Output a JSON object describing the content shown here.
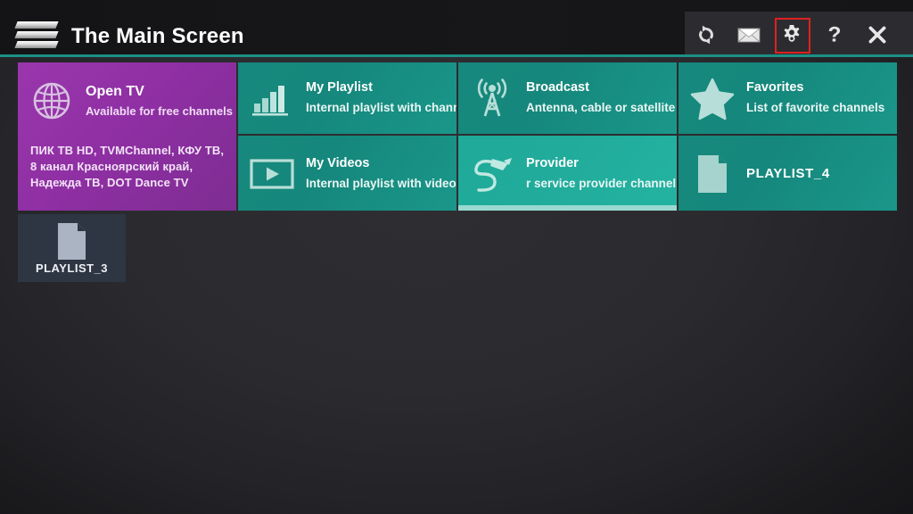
{
  "header": {
    "menu_icon": "hamburger-menu-icon",
    "title": "The Main Screen",
    "buttons": [
      {
        "name": "refresh-button",
        "icon": "refresh-icon",
        "label": "Refresh"
      },
      {
        "name": "mail-button",
        "icon": "mail-icon",
        "label": "Mail"
      },
      {
        "name": "settings-button",
        "icon": "gear-icon",
        "label": "Settings",
        "highlighted": true,
        "highlight_color": "#e02020"
      },
      {
        "name": "help-button",
        "icon": "question-mark-icon",
        "label": "Help"
      },
      {
        "name": "close-button",
        "icon": "close-icon",
        "label": "Close"
      }
    ]
  },
  "colors": {
    "accent_teal": "#1c8f86",
    "tile_teal": "#17887d",
    "tile_teal_bright": "#1faa99",
    "tile_purple": "#8e2fa3",
    "tile_dark": "#2e3644",
    "background": "#2b2b2f",
    "highlight_red": "#e02020"
  },
  "tiles": {
    "open_tv": {
      "icon": "globe-icon",
      "title": "Open TV",
      "subtitle": "Available for free channels",
      "channels": "ПИК ТВ HD, TVMChannel, КФУ ТВ, 8 канал Красноярский край, Надежда ТВ, DOT Dance TV"
    },
    "my_playlist": {
      "icon": "bar-chart-icon",
      "title": "My Playlist",
      "subtitle": "Internal playlist with chann"
    },
    "broadcast": {
      "icon": "antenna-tower-icon",
      "title": "Broadcast",
      "subtitle": "Antenna, cable or satellite"
    },
    "favorites": {
      "icon": "star-icon",
      "title": "Favorites",
      "subtitle": "List of favorite channels"
    },
    "my_videos": {
      "icon": "video-play-icon",
      "title": "My Videos",
      "subtitle": "Internal playlist with video"
    },
    "provider": {
      "icon": "plug-cable-icon",
      "title": "Provider",
      "subtitle": "r service provider channels",
      "selected": true
    },
    "playlist_4": {
      "icon": "document-icon",
      "title": "PLAYLIST_4"
    },
    "playlist_3": {
      "icon": "document-icon",
      "title": "PLAYLIST_3"
    }
  }
}
